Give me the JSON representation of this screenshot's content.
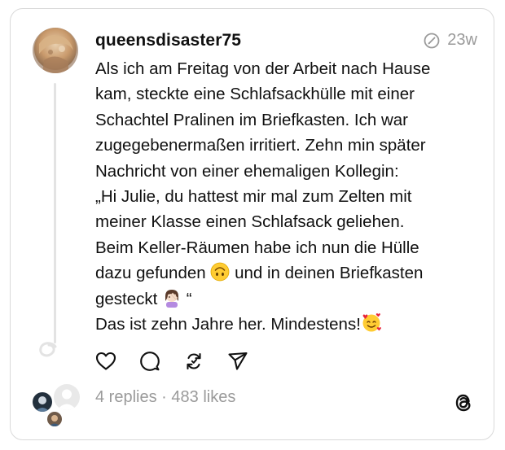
{
  "post": {
    "username": "queensdisaster75",
    "time": "23w",
    "lines": [
      "Als ich am Freitag von der Arbeit nach Hause",
      "kam, steckte eine Schlafsackhülle mit einer",
      "Schachtel Pralinen im Briefkasten. Ich war",
      "zugegebenermaßen irritiert. Zehn min später",
      "Nachricht von einer ehemaligen Kollegin:",
      "„Hi Julie, du hattest mir mal zum Zelten mit",
      "meiner Klasse einen Schlafsack geliehen.",
      "Beim Keller-Räumen habe ich nun die Hülle",
      "dazu gefunden",
      "und in deinen Briefkasten",
      "gesteckt",
      "“",
      "Das ist zehn Jahre her. Mindestens!"
    ],
    "emojis": {
      "upside_down": "upside-down-face-emoji",
      "facepalm": "woman-facepalming-emoji",
      "hearts": "smiling-face-with-hearts-emoji"
    }
  },
  "stats": {
    "replies": "4 replies",
    "separator": " · ",
    "likes": "483 likes"
  },
  "icons": {
    "time_icon": "edited-indicator-icon",
    "like": "heart-icon",
    "reply": "comment-icon",
    "repost": "repost-icon",
    "share": "share-icon",
    "brand": "threads-logo-icon"
  },
  "colors": {
    "text": "#101010",
    "muted": "#9a9a9a",
    "border": "#d9d9d9",
    "thread_line": "#e3e3e3"
  }
}
